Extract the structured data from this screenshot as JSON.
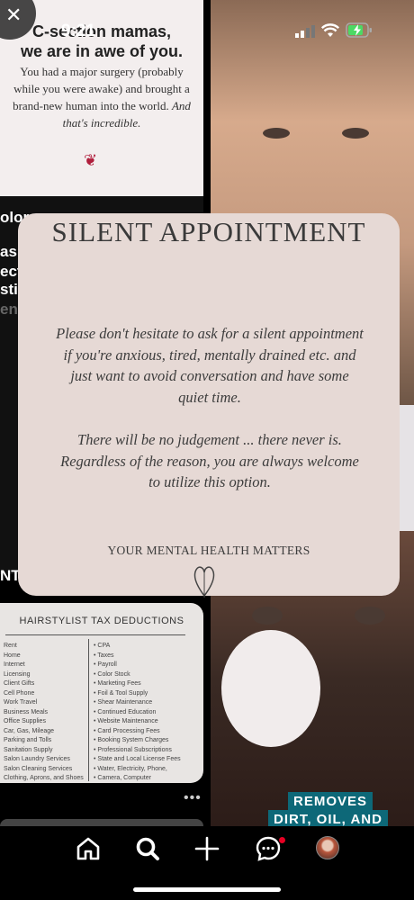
{
  "status_bar": {
    "time": "9:21"
  },
  "feed": {
    "card1": {
      "heading_line1": "C-section mamas,",
      "heading_line2": "we are in awe of you.",
      "body": "You had a major surgery (probably while you were awake) and brought a brand-new human into the world.",
      "body_emphasis": "And that's incredible."
    },
    "left_mid_fragments": [
      "olor",
      "as",
      "ect",
      "sti",
      "ens",
      "NT"
    ],
    "tax_card": {
      "title": "HAIRSTYLIST TAX DEDUCTIONS",
      "left_items": [
        "Rent",
        "Home",
        "Internet",
        "Licensing",
        "Client Gifts",
        "Cell Phone",
        "Work Travel",
        "Business Meals",
        "Office Supplies",
        "Car, Gas, Mileage",
        "Parking and Tolls",
        "Sanitation Supply",
        "Salon Laundry Services",
        "Salon Cleaning Services",
        "Clothing, Aprons, and Shoes"
      ],
      "right_items": [
        "CPA",
        "Taxes",
        "Payroll",
        "Color Stock",
        "Marketing Fees",
        "Foil & Tool Supply",
        "Shear Maintenance",
        "Continued Education",
        "Website Maintenance",
        "Card Processing Fees",
        "Booking System Charges",
        "Professional Subscriptions",
        "State and Local License Fees",
        "Water, Electricity, Phone,",
        "Camera, Computer"
      ]
    },
    "ad_badge_line1": "REMOVES",
    "ad_badge_line2": "DIRT, OIL, AND"
  },
  "modal": {
    "title": "SILENT APPOINTMENT",
    "para1_lines": [
      "Please don't hesitate to ask for a silent appointment",
      "if you're anxious, tired, mentally drained etc. and",
      "just want to avoid conversation and have some",
      "quiet time."
    ],
    "para2_lines": [
      "There will be  no judgement ... there never is.",
      "Regardless of the reason, you are always welcome",
      "to utilize this option."
    ],
    "footer": "YOUR MENTAL HEALTH MATTERS"
  },
  "nav": {
    "items": [
      "home-icon",
      "search-icon",
      "create-icon",
      "messages-icon",
      "profile-avatar"
    ],
    "notification_color": "#e60023"
  },
  "colors": {
    "modal_bg": "#e6d9d5",
    "ad_badge": "#0d6878"
  }
}
